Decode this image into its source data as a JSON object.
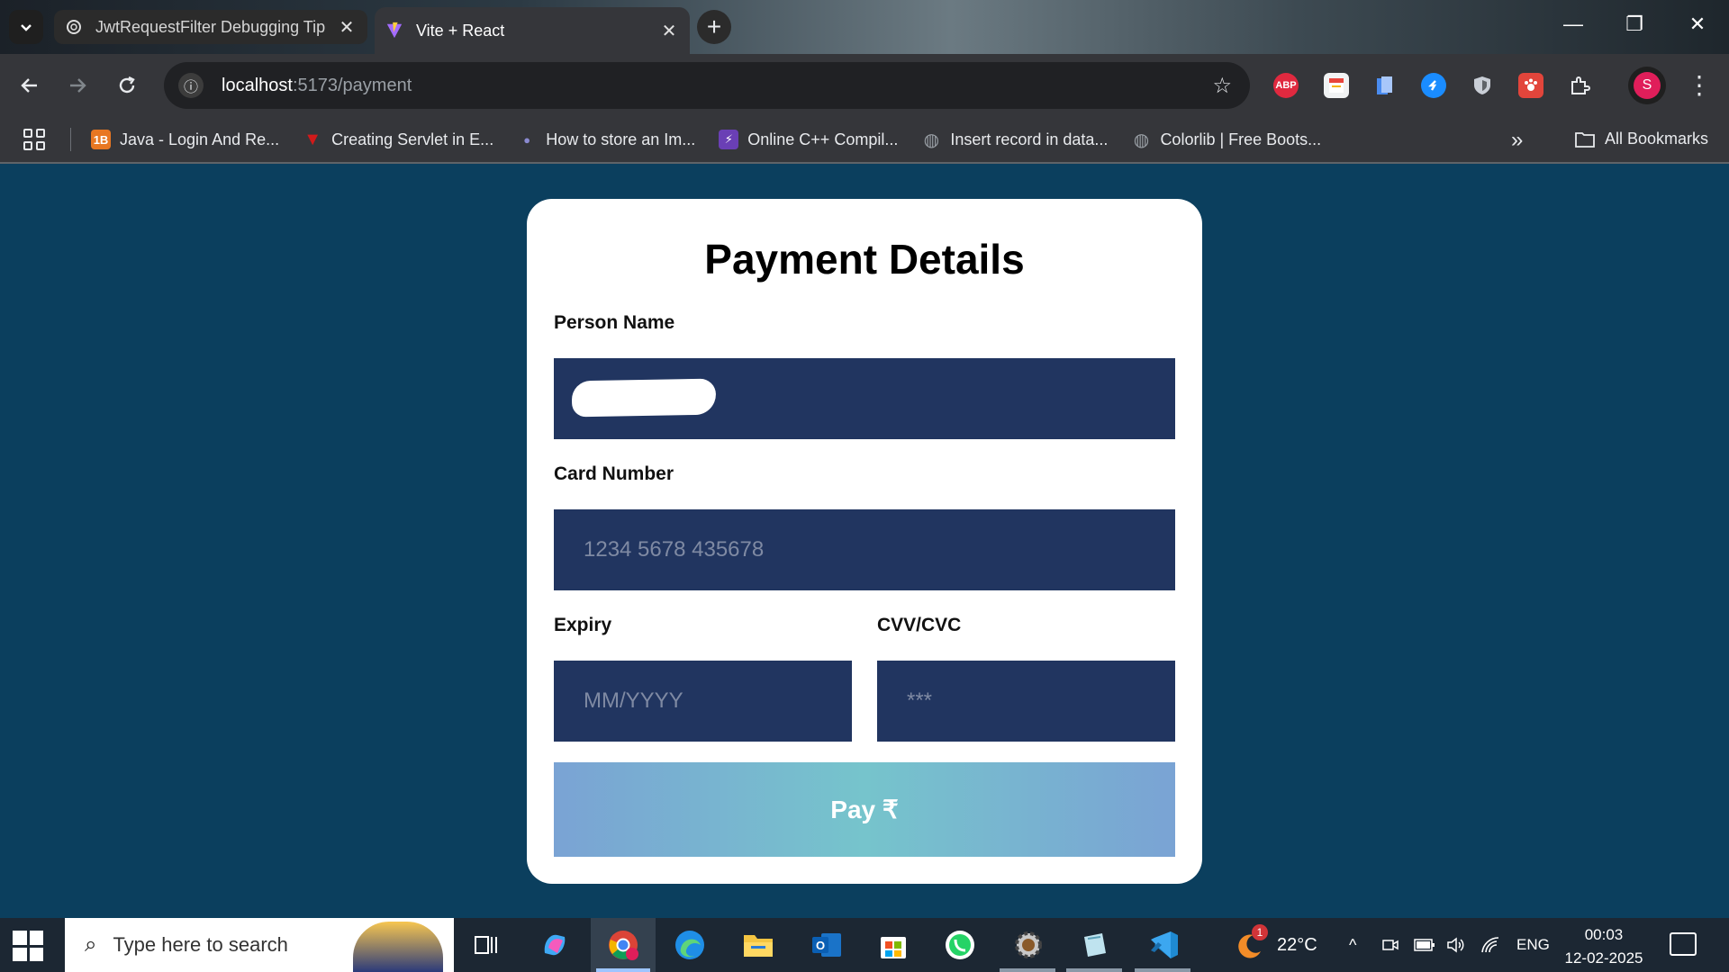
{
  "browser": {
    "tabs": [
      {
        "title": "JwtRequestFilter Debugging Tip",
        "active": false,
        "favicon": "openai-icon"
      },
      {
        "title": "Vite + React",
        "active": true,
        "favicon": "vite-icon"
      }
    ],
    "new_tab_label": "+",
    "address": {
      "host": "localhost",
      "rest": ":5173/payment"
    },
    "extensions": [
      {
        "name": "adblock-plus-icon",
        "label": "ABP",
        "color": "#e0293f"
      },
      {
        "name": "calendar-extension-icon",
        "label": "",
        "color": "#e8eaed"
      },
      {
        "name": "docs-extension-icon",
        "label": "",
        "color": "#4a8cf0"
      },
      {
        "name": "shazam-icon",
        "label": "",
        "color": "#1a8cff"
      },
      {
        "name": "shield-extension-icon",
        "label": "",
        "color": "#c9ced6"
      },
      {
        "name": "paw-extension-icon",
        "label": "",
        "color": "#e2453b"
      },
      {
        "name": "puzzle-extensions-icon",
        "label": "",
        "color": "transparent"
      }
    ],
    "profile_initial": "S",
    "bookmarks": [
      {
        "label": "Java - Login And Re...",
        "icon": "java-bookmark-icon",
        "color": "#e87722",
        "glyph": "1B"
      },
      {
        "label": "Creating Servlet in E...",
        "icon": "servlet-bookmark-icon",
        "color": "#d11a1a",
        "glyph": "▼"
      },
      {
        "label": "How to store an Im...",
        "icon": "image-bookmark-icon",
        "color": "#4a4a8a",
        "glyph": "●"
      },
      {
        "label": "Online C++ Compil...",
        "icon": "compiler-bookmark-icon",
        "color": "#6a3fb5",
        "glyph": "⚡"
      },
      {
        "label": "Insert record in data...",
        "icon": "globe-bookmark-icon",
        "color": "#6b6f75",
        "glyph": "◍"
      },
      {
        "label": "Colorlib | Free Boots...",
        "icon": "globe-bookmark-icon",
        "color": "#6b6f75",
        "glyph": "◍"
      }
    ],
    "bookmarks_more": "»",
    "all_bookmarks": "All Bookmarks"
  },
  "payment": {
    "title": "Payment Details",
    "person_name_label": "Person Name",
    "card_number_label": "Card Number",
    "card_number_placeholder": "1234 5678 435678",
    "expiry_label": "Expiry",
    "expiry_placeholder": "MM/YYYY",
    "cvv_label": "CVV/CVC",
    "cvv_placeholder": "***",
    "pay_button": "Pay ₹"
  },
  "taskbar": {
    "search_placeholder": "Type here to search",
    "weather_badge": "1",
    "temperature": "22°C",
    "language": "ENG",
    "time": "00:03",
    "date": "12-02-2025"
  }
}
